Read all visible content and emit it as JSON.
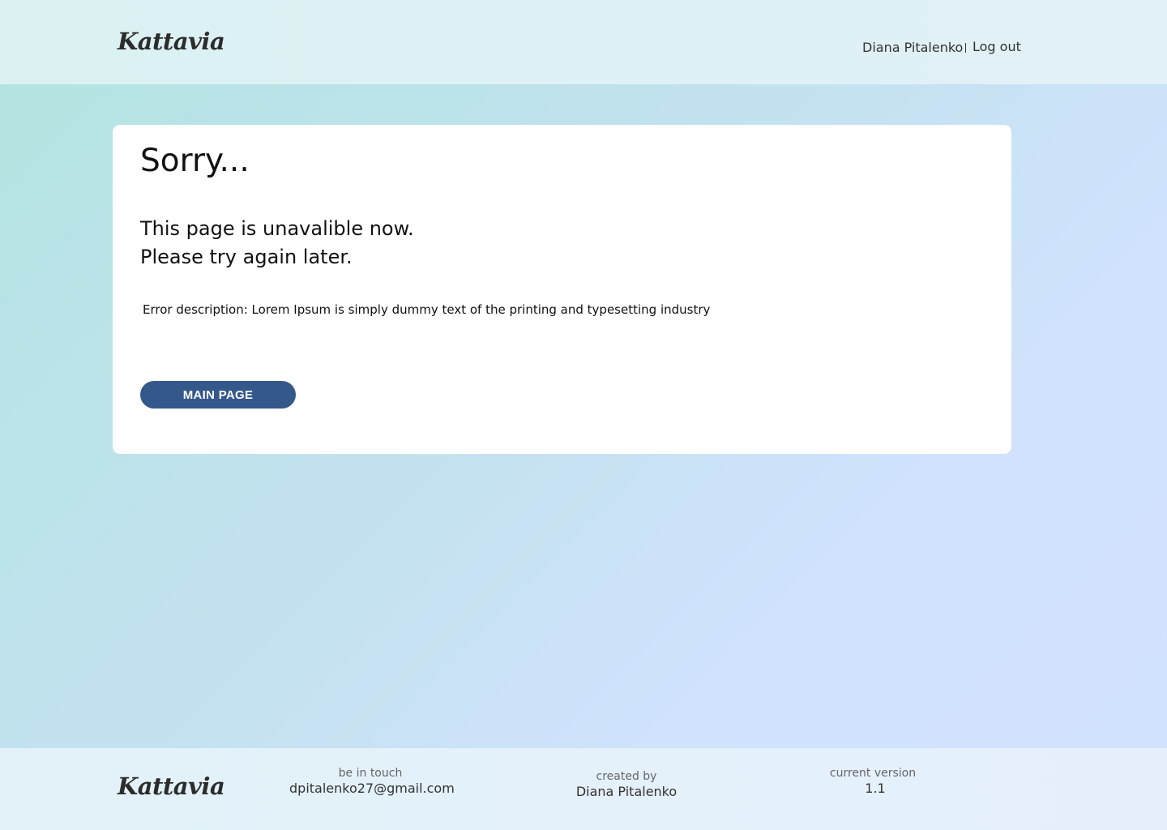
{
  "header": {
    "logo": "Kattavia",
    "user_name": "Diana Pitalenko",
    "logout_label": "Log out"
  },
  "card": {
    "title": "Sorry...",
    "message_line1": "This page is unavalible now.",
    "message_line2": "Please try again later.",
    "error_description": "Error description: Lorem Ipsum is simply dummy text of the printing and typesetting industry",
    "button_label": "MAIN PAGE"
  },
  "footer": {
    "logo": "Kattavia",
    "contact_label": "be in touch",
    "contact_email": "dpitalenko27@gmail.com",
    "created_label": "created by",
    "created_name": "Diana Pitalenko",
    "version_label": "current version",
    "version_value": "1.1"
  },
  "colors": {
    "accent_button": "#35588a",
    "header_bg": "#dbf1f2",
    "footer_bg": "#e4f0fa",
    "page_gradient_start": "#b3e4e0",
    "page_gradient_end": "#d3e3ff"
  }
}
